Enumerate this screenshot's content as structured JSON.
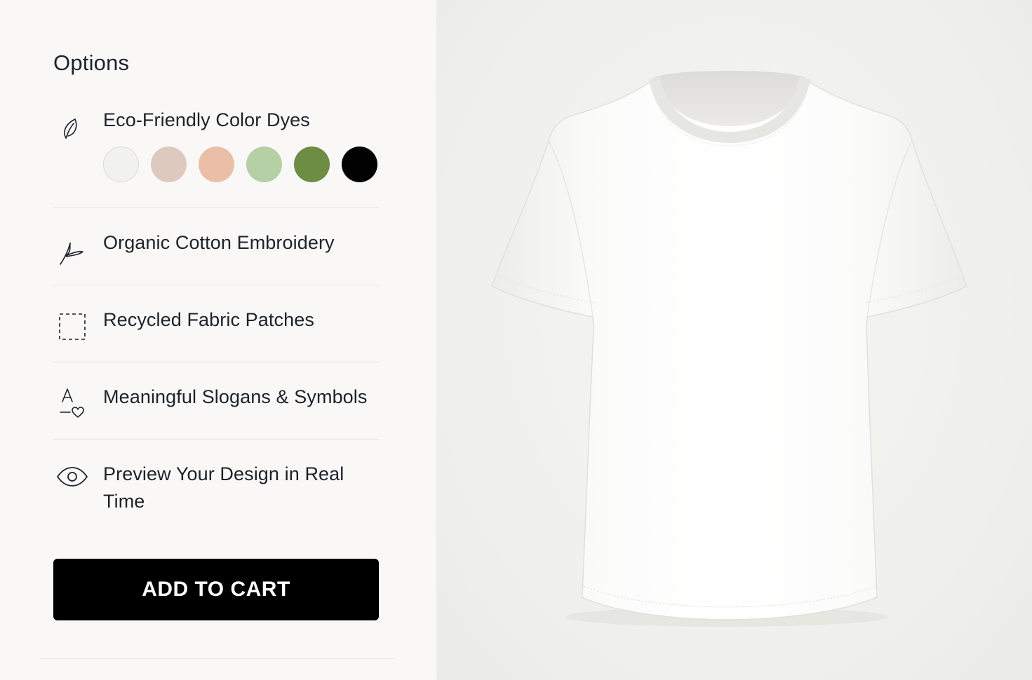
{
  "options_panel": {
    "title": "Options",
    "items": [
      {
        "label": "Eco-Friendly Color Dyes",
        "icon": "leaf-icon"
      },
      {
        "label": "Organic Cotton Embroidery",
        "icon": "embroidery-needle-icon"
      },
      {
        "label": "Recycled Fabric Patches",
        "icon": "patch-outline-icon"
      },
      {
        "label": "Meaningful Slogans & Symbols",
        "icon": "text-heart-icon"
      },
      {
        "label": "Preview Your Design in Real Time",
        "icon": "eye-icon"
      }
    ],
    "color_swatches": [
      {
        "color": "#f1f1f0"
      },
      {
        "color": "#ddc9bd"
      },
      {
        "color": "#ebbea7"
      },
      {
        "color": "#b6d0a6"
      },
      {
        "color": "#6d8c44"
      },
      {
        "color": "#020202"
      }
    ],
    "add_to_cart_label": "ADD TO CART"
  },
  "preview": {
    "product": "t-shirt",
    "shirt_color": "#ffffff"
  }
}
